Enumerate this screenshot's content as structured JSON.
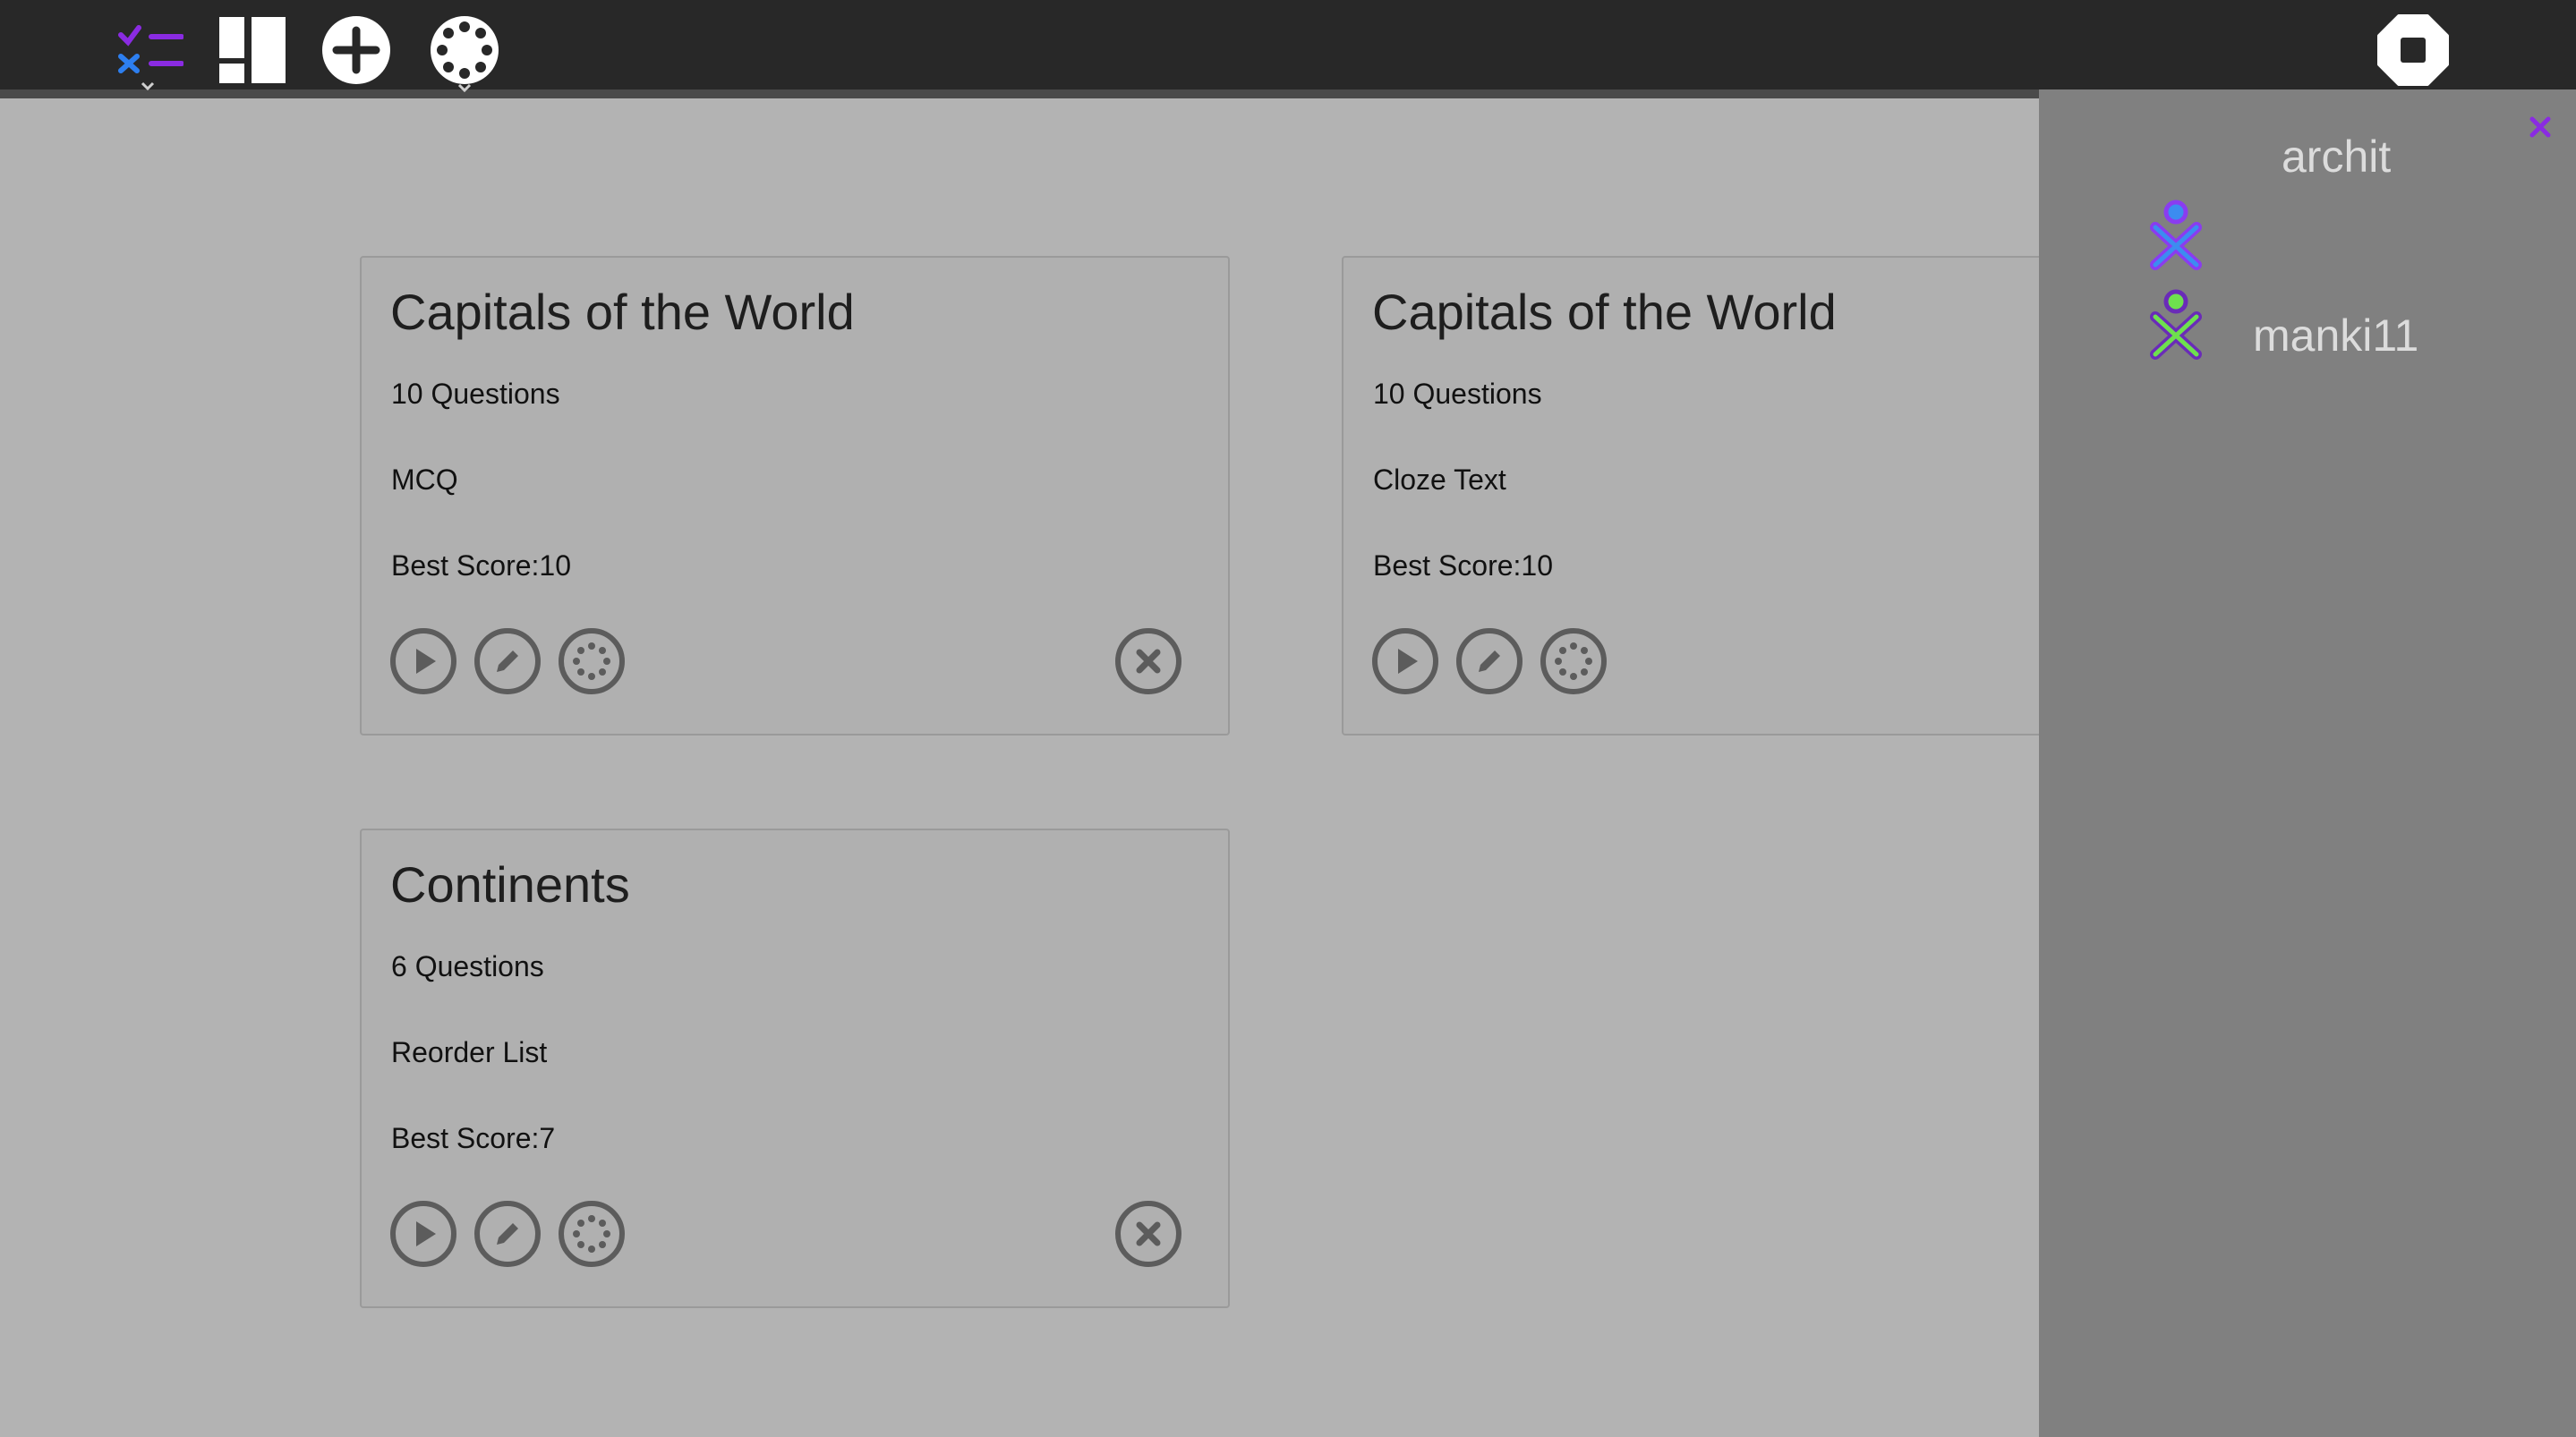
{
  "toolbar": {
    "buttons": [
      {
        "name": "exercise-list-icon"
      },
      {
        "name": "grid-view-icon"
      },
      {
        "name": "add-icon"
      },
      {
        "name": "network-icon"
      },
      {
        "name": "stop-icon"
      }
    ]
  },
  "cards": [
    {
      "title": "Capitals of the World",
      "questions": "10 Questions",
      "type": "MCQ",
      "score": "Best Score:10",
      "deletable": true
    },
    {
      "title": "Capitals of the World",
      "questions": "10 Questions",
      "type": "Cloze Text",
      "score": "Best Score:10",
      "deletable": false
    },
    {
      "title": "Continents",
      "questions": "6 Questions",
      "type": "Reorder List",
      "score": "Best Score:7",
      "deletable": true
    }
  ],
  "sidebar": {
    "close_icon": "close-icon",
    "users": [
      {
        "name": "archit",
        "stroke": "#8a3cf0",
        "fill": "#3c8cf0"
      },
      {
        "name": "manki11",
        "stroke": "#6a2bb8",
        "fill": "#6ee04e"
      }
    ]
  },
  "colors": {
    "toolbar": "#282828",
    "background": "#b3b3b3",
    "sidebar": "#808080",
    "accent": "#8a2be2"
  }
}
